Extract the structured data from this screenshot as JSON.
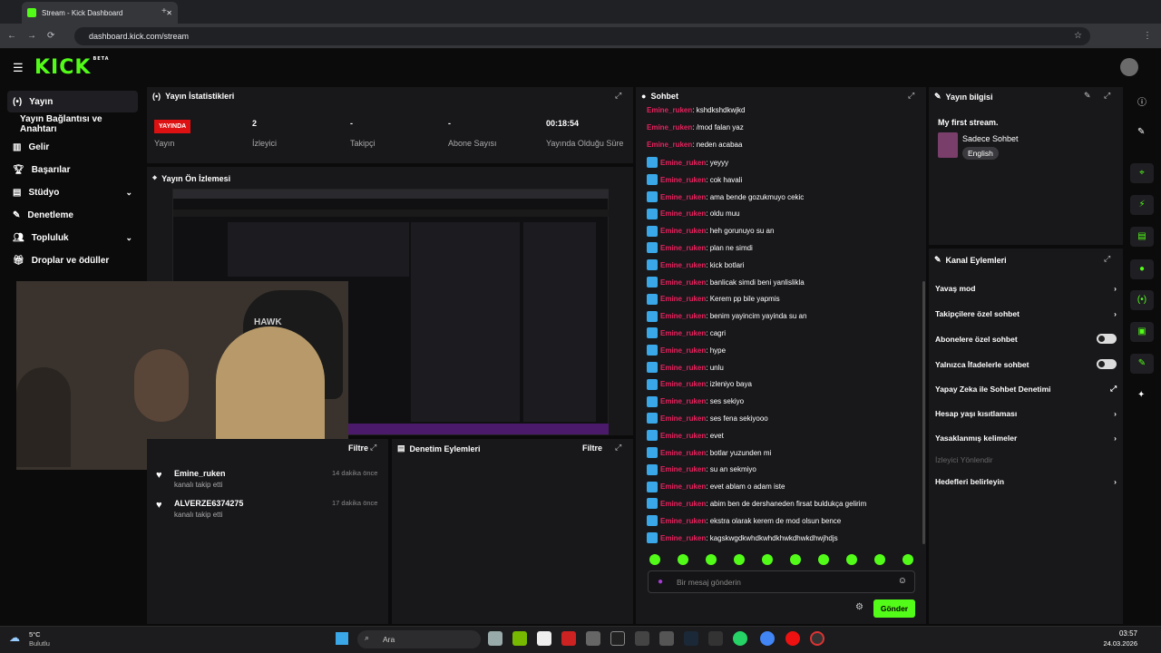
{
  "browser": {
    "tab_title": "Stream - Kick Dashboard",
    "url": "dashboard.kick.com/stream"
  },
  "brand": {
    "logo": "KICK",
    "logo_badge": "BETA",
    "accent": "#53fc18"
  },
  "sidebar": {
    "items": [
      {
        "label": "Yayın"
      },
      {
        "label": "Yayın Bağlantısı ve Anahtarı"
      },
      {
        "label": "Gelir"
      },
      {
        "label": "Başarılar"
      },
      {
        "label": "Stüdyo"
      },
      {
        "label": "Denetleme"
      },
      {
        "label": "Topluluk"
      },
      {
        "label": "Droplar ve ödüller"
      }
    ]
  },
  "stats": {
    "title": "Yayın İstatistikleri",
    "status_badge": "YAYINDA",
    "status_label": "Yayın",
    "viewers_value": "2",
    "viewers_label": "İzleyici",
    "followers_value": "-",
    "followers_label": "Takipçi",
    "subs_value": "-",
    "subs_label": "Abone Sayısı",
    "duration_value": "00:18:54",
    "duration_label": "Yayında Olduğu Süre"
  },
  "preview": {
    "title": "Yayın Ön İzlemesi",
    "overlay_text": "HAWK"
  },
  "activity": {
    "filter_label": "Filtre",
    "events": [
      {
        "user": "Emine_ruken",
        "action": "kanalı takip etti",
        "time": "14 dakika önce"
      },
      {
        "user": "ALVERZE6374275",
        "action": "kanalı takip etti",
        "time": "17 dakika önce"
      }
    ]
  },
  "moderation": {
    "title": "Denetim Eylemleri",
    "filter_label": "Filtre"
  },
  "chat": {
    "title": "Sohbet",
    "placeholder": "Bir mesaj gönderin",
    "send_label": "Gönder",
    "messages": [
      {
        "user": "Emine_ruken",
        "text": ": kshdkshdkwjkd"
      },
      {
        "user": "Emine_ruken",
        "text": ": /mod falan yaz"
      },
      {
        "user": "Emine_ruken",
        "text": ": neden acabaa"
      },
      {
        "user": "Emine_ruken",
        "text": ": yeyyy"
      },
      {
        "user": "Emine_ruken",
        "text": ": cok havali"
      },
      {
        "user": "Emine_ruken",
        "text": ": ama bende gozukmuyo cekic"
      },
      {
        "user": "Emine_ruken",
        "text": ": oldu muu"
      },
      {
        "user": "Emine_ruken",
        "text": ": heh gorunuyo su an"
      },
      {
        "user": "Emine_ruken",
        "text": ": plan ne simdi"
      },
      {
        "user": "Emine_ruken",
        "text": ": kick botlari"
      },
      {
        "user": "Emine_ruken",
        "text": ": banlicak simdi beni yanlislikla"
      },
      {
        "user": "Emine_ruken",
        "text": ": Kerem pp bile yapmis"
      },
      {
        "user": "Emine_ruken",
        "text": ": benim yayincim yayinda su an"
      },
      {
        "user": "Emine_ruken",
        "text": ": cagri"
      },
      {
        "user": "Emine_ruken",
        "text": ": hype"
      },
      {
        "user": "Emine_ruken",
        "text": ": unlu"
      },
      {
        "user": "Emine_ruken",
        "text": ": izleniyo baya"
      },
      {
        "user": "Emine_ruken",
        "text": ": ses sekiyo"
      },
      {
        "user": "Emine_ruken",
        "text": ": ses fena sekiyooo"
      },
      {
        "user": "Emine_ruken",
        "text": ": evet"
      },
      {
        "user": "Emine_ruken",
        "text": ": botlar yuzunden mi"
      },
      {
        "user": "Emine_ruken",
        "text": ": su an sekmiyo"
      },
      {
        "user": "Emine_ruken",
        "text": ": evet ablam o adam iste"
      },
      {
        "user": "Emine_ruken",
        "text": ": abim ben de dershaneden firsat buldukça gelirim"
      },
      {
        "user": "Emine_ruken",
        "text": ": ekstra olarak kerem de mod olsun bence"
      },
      {
        "user": "Emine_ruken",
        "text": ": kagskwgdkwhdkwhdkhwkdhwkdhwjhdjs"
      }
    ]
  },
  "stream_info": {
    "title": "Yayın bilgisi",
    "stream_title": "My first stream.",
    "category": "Sadece Sohbet",
    "language": "English"
  },
  "channel_actions": {
    "title": "Kanal Eylemleri",
    "items": [
      {
        "label": "Yavaş mod"
      },
      {
        "label": "Takipçilere özel sohbet"
      },
      {
        "label": "Abonelere özel sohbet"
      },
      {
        "label": "Yalnızca İfadelerle sohbet"
      },
      {
        "label": "Yapay Zeka ile Sohbet Denetimi"
      },
      {
        "label": "Hesap yaşı kısıtlaması"
      },
      {
        "label": "Yasaklanmış kelimeler"
      },
      {
        "label": "İzleyici Yönlendir"
      },
      {
        "label": "Hedefleri belirleyin"
      }
    ]
  },
  "taskbar": {
    "weather_temp": "5°C",
    "weather_desc": "Bulutlu",
    "search_label": "Ara",
    "time": "03:57",
    "date": "24.03.2026"
  }
}
